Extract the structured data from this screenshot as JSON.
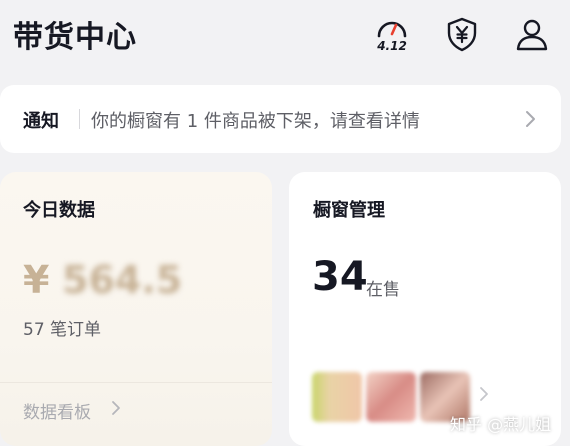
{
  "header": {
    "title": "带货中心",
    "score_value": "4.12",
    "icons": [
      "speedometer-icon",
      "shield-yen-icon",
      "user-icon"
    ]
  },
  "notice": {
    "tag": "通知",
    "text": "你的橱窗有 1 件商品被下架，请查看详情"
  },
  "today_data": {
    "title": "今日数据",
    "currency": "¥",
    "amount": "564.5",
    "orders": "57 笔订单",
    "link_label": "数据看板"
  },
  "showcase": {
    "title": "橱窗管理",
    "count": "34",
    "count_label": "在售",
    "thumbnail_colors": [
      "#e6c9a8",
      "#d9a79d",
      "#b98a82"
    ]
  },
  "watermark": "知乎 @燕儿姐",
  "colors": {
    "background": "#f2f2f4",
    "card": "#ffffff",
    "amount_gold": "#c7b296",
    "text_primary": "#161823",
    "text_secondary": "#5e5f66"
  }
}
